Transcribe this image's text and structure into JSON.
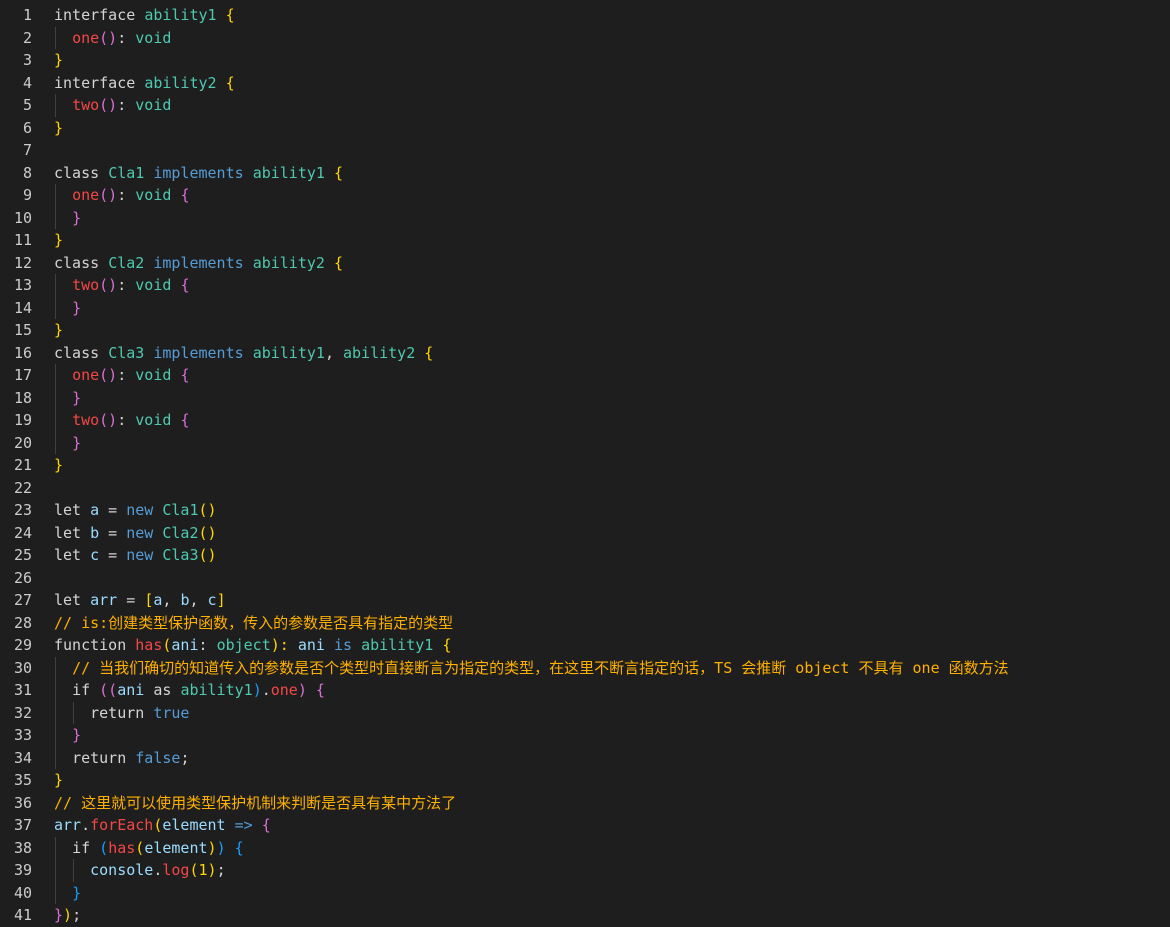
{
  "editor": {
    "lines": [
      {
        "n": "1",
        "tokens": [
          [
            "interface ",
            "kw"
          ],
          [
            "ability1",
            "ty"
          ],
          [
            " ",
            "pl"
          ],
          [
            "{",
            "p1"
          ]
        ]
      },
      {
        "n": "2",
        "tokens": [
          [
            "  ",
            "pl"
          ],
          [
            "one",
            "fn"
          ],
          [
            "()",
            "p2"
          ],
          [
            ": ",
            "pl"
          ],
          [
            "void",
            "ty"
          ]
        ]
      },
      {
        "n": "3",
        "tokens": [
          [
            "}",
            "p1"
          ]
        ]
      },
      {
        "n": "4",
        "tokens": [
          [
            "interface ",
            "kw"
          ],
          [
            "ability2",
            "ty"
          ],
          [
            " ",
            "pl"
          ],
          [
            "{",
            "p1"
          ]
        ]
      },
      {
        "n": "5",
        "tokens": [
          [
            "  ",
            "pl"
          ],
          [
            "two",
            "fn"
          ],
          [
            "()",
            "p2"
          ],
          [
            ": ",
            "pl"
          ],
          [
            "void",
            "ty"
          ]
        ]
      },
      {
        "n": "6",
        "tokens": [
          [
            "}",
            "p1"
          ]
        ]
      },
      {
        "n": "7",
        "tokens": []
      },
      {
        "n": "8",
        "tokens": [
          [
            "class ",
            "kw"
          ],
          [
            "Cla1",
            "ty"
          ],
          [
            " ",
            "pl"
          ],
          [
            "implements",
            "kb"
          ],
          [
            " ",
            "pl"
          ],
          [
            "ability1",
            "ty"
          ],
          [
            " ",
            "pl"
          ],
          [
            "{",
            "p1"
          ]
        ]
      },
      {
        "n": "9",
        "tokens": [
          [
            "  ",
            "pl"
          ],
          [
            "one",
            "fn"
          ],
          [
            "()",
            "p2"
          ],
          [
            ": ",
            "pl"
          ],
          [
            "void",
            "ty"
          ],
          [
            " ",
            "pl"
          ],
          [
            "{",
            "p2"
          ]
        ]
      },
      {
        "n": "10",
        "tokens": [
          [
            "  ",
            "pl"
          ],
          [
            "}",
            "p2"
          ]
        ]
      },
      {
        "n": "11",
        "tokens": [
          [
            "}",
            "p1"
          ]
        ]
      },
      {
        "n": "12",
        "tokens": [
          [
            "class ",
            "kw"
          ],
          [
            "Cla2",
            "ty"
          ],
          [
            " ",
            "pl"
          ],
          [
            "implements",
            "kb"
          ],
          [
            " ",
            "pl"
          ],
          [
            "ability2",
            "ty"
          ],
          [
            " ",
            "pl"
          ],
          [
            "{",
            "p1"
          ]
        ]
      },
      {
        "n": "13",
        "tokens": [
          [
            "  ",
            "pl"
          ],
          [
            "two",
            "fn"
          ],
          [
            "()",
            "p2"
          ],
          [
            ": ",
            "pl"
          ],
          [
            "void",
            "ty"
          ],
          [
            " ",
            "pl"
          ],
          [
            "{",
            "p2"
          ]
        ]
      },
      {
        "n": "14",
        "tokens": [
          [
            "  ",
            "pl"
          ],
          [
            "}",
            "p2"
          ]
        ]
      },
      {
        "n": "15",
        "tokens": [
          [
            "}",
            "p1"
          ]
        ]
      },
      {
        "n": "16",
        "tokens": [
          [
            "class ",
            "kw"
          ],
          [
            "Cla3",
            "ty"
          ],
          [
            " ",
            "pl"
          ],
          [
            "implements",
            "kb"
          ],
          [
            " ",
            "pl"
          ],
          [
            "ability1",
            "ty"
          ],
          [
            ", ",
            "pl"
          ],
          [
            "ability2",
            "ty"
          ],
          [
            " ",
            "pl"
          ],
          [
            "{",
            "p1"
          ]
        ]
      },
      {
        "n": "17",
        "tokens": [
          [
            "  ",
            "pl"
          ],
          [
            "one",
            "fn"
          ],
          [
            "()",
            "p2"
          ],
          [
            ": ",
            "pl"
          ],
          [
            "void",
            "ty"
          ],
          [
            " ",
            "pl"
          ],
          [
            "{",
            "p2"
          ]
        ]
      },
      {
        "n": "18",
        "tokens": [
          [
            "  ",
            "pl"
          ],
          [
            "}",
            "p2"
          ]
        ]
      },
      {
        "n": "19",
        "tokens": [
          [
            "  ",
            "pl"
          ],
          [
            "two",
            "fn"
          ],
          [
            "()",
            "p2"
          ],
          [
            ": ",
            "pl"
          ],
          [
            "void",
            "ty"
          ],
          [
            " ",
            "pl"
          ],
          [
            "{",
            "p2"
          ]
        ]
      },
      {
        "n": "20",
        "tokens": [
          [
            "  ",
            "pl"
          ],
          [
            "}",
            "p2"
          ]
        ]
      },
      {
        "n": "21",
        "tokens": [
          [
            "}",
            "p1"
          ]
        ]
      },
      {
        "n": "22",
        "tokens": []
      },
      {
        "n": "23",
        "tokens": [
          [
            "let ",
            "kw"
          ],
          [
            "a",
            "vr"
          ],
          [
            " = ",
            "pl"
          ],
          [
            "new",
            "kb"
          ],
          [
            " ",
            "pl"
          ],
          [
            "Cla1",
            "ty"
          ],
          [
            "()",
            "p1"
          ]
        ]
      },
      {
        "n": "24",
        "tokens": [
          [
            "let ",
            "kw"
          ],
          [
            "b",
            "vr"
          ],
          [
            " = ",
            "pl"
          ],
          [
            "new",
            "kb"
          ],
          [
            " ",
            "pl"
          ],
          [
            "Cla2",
            "ty"
          ],
          [
            "()",
            "p1"
          ]
        ]
      },
      {
        "n": "25",
        "tokens": [
          [
            "let ",
            "kw"
          ],
          [
            "c",
            "vr"
          ],
          [
            " = ",
            "pl"
          ],
          [
            "new",
            "kb"
          ],
          [
            " ",
            "pl"
          ],
          [
            "Cla3",
            "ty"
          ],
          [
            "()",
            "p1"
          ]
        ]
      },
      {
        "n": "26",
        "tokens": []
      },
      {
        "n": "27",
        "tokens": [
          [
            "let ",
            "kw"
          ],
          [
            "arr",
            "vr"
          ],
          [
            " = ",
            "pl"
          ],
          [
            "[",
            "p1"
          ],
          [
            "a",
            "vr"
          ],
          [
            ", ",
            "pl"
          ],
          [
            "b",
            "vr"
          ],
          [
            ", ",
            "pl"
          ],
          [
            "c",
            "vr"
          ],
          [
            "]",
            "p1"
          ]
        ]
      },
      {
        "n": "28",
        "tokens": [
          [
            "// is:创建类型保护函数，传入的参数是否具有指定的类型",
            "cm"
          ]
        ]
      },
      {
        "n": "29",
        "tokens": [
          [
            "function ",
            "kw"
          ],
          [
            "has",
            "fn"
          ],
          [
            "(",
            "p1"
          ],
          [
            "ani",
            "vr"
          ],
          [
            ": ",
            "pl"
          ],
          [
            "object",
            "ty"
          ],
          [
            "): ",
            "p1"
          ],
          [
            "ani",
            "vr"
          ],
          [
            " ",
            "pl"
          ],
          [
            "is",
            "kb"
          ],
          [
            " ",
            "pl"
          ],
          [
            "ability1",
            "ty"
          ],
          [
            " ",
            "pl"
          ],
          [
            "{",
            "p1"
          ]
        ]
      },
      {
        "n": "30",
        "tokens": [
          [
            "  ",
            "pl"
          ],
          [
            "// 当我们确切的知道传入的参数是否个类型时直接断言为指定的类型，在这里不断言指定的话，TS 会推断 object 不具有 one 函数方法",
            "cm"
          ]
        ]
      },
      {
        "n": "31",
        "tokens": [
          [
            "  ",
            "pl"
          ],
          [
            "if ",
            "kw"
          ],
          [
            "((",
            "p2"
          ],
          [
            "ani",
            "vr"
          ],
          [
            " as ",
            "kw"
          ],
          [
            "ability1",
            "ty"
          ],
          [
            ")",
            "p3"
          ],
          [
            ".",
            "pl"
          ],
          [
            "one",
            "fn"
          ],
          [
            ")",
            "p2"
          ],
          [
            " ",
            "pl"
          ],
          [
            "{",
            "p2"
          ]
        ]
      },
      {
        "n": "32",
        "tokens": [
          [
            "    ",
            "pl"
          ],
          [
            "return ",
            "kw"
          ],
          [
            "true",
            "kb"
          ]
        ]
      },
      {
        "n": "33",
        "tokens": [
          [
            "  ",
            "pl"
          ],
          [
            "}",
            "p2"
          ]
        ]
      },
      {
        "n": "34",
        "tokens": [
          [
            "  ",
            "pl"
          ],
          [
            "return ",
            "kw"
          ],
          [
            "false",
            "kb"
          ],
          [
            ";",
            "pl"
          ]
        ]
      },
      {
        "n": "35",
        "tokens": [
          [
            "}",
            "p1"
          ]
        ]
      },
      {
        "n": "36",
        "tokens": [
          [
            "// 这里就可以使用类型保护机制来判断是否具有某中方法了",
            "cm"
          ]
        ]
      },
      {
        "n": "37",
        "tokens": [
          [
            "arr",
            "vr"
          ],
          [
            ".",
            "pl"
          ],
          [
            "forEach",
            "fn"
          ],
          [
            "(",
            "p1"
          ],
          [
            "element",
            "vr"
          ],
          [
            " => ",
            "kb"
          ],
          [
            "{",
            "p2"
          ]
        ]
      },
      {
        "n": "38",
        "tokens": [
          [
            "  ",
            "pl"
          ],
          [
            "if ",
            "kw"
          ],
          [
            "(",
            "p3"
          ],
          [
            "has",
            "fn"
          ],
          [
            "(",
            "p1"
          ],
          [
            "element",
            "vr"
          ],
          [
            ")",
            "p1"
          ],
          [
            ")",
            "p3"
          ],
          [
            " ",
            "pl"
          ],
          [
            "{",
            "p3"
          ]
        ]
      },
      {
        "n": "39",
        "tokens": [
          [
            "    ",
            "pl"
          ],
          [
            "console",
            "vr"
          ],
          [
            ".",
            "pl"
          ],
          [
            "log",
            "fn"
          ],
          [
            "(",
            "p1"
          ],
          [
            "1",
            "p1"
          ],
          [
            ")",
            "p1"
          ],
          [
            ";",
            "pl"
          ]
        ]
      },
      {
        "n": "40",
        "tokens": [
          [
            "  ",
            "pl"
          ],
          [
            "}",
            "p3"
          ]
        ]
      },
      {
        "n": "41",
        "tokens": [
          [
            "}",
            "p2"
          ],
          [
            ")",
            "p1"
          ],
          [
            ";",
            "pl"
          ]
        ]
      }
    ]
  }
}
